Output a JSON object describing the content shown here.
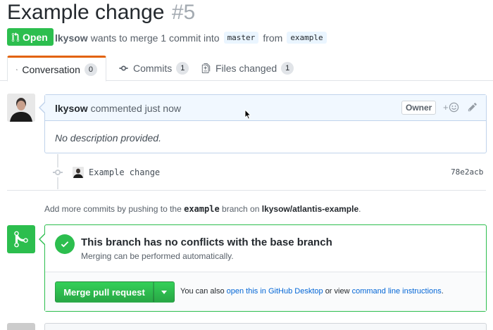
{
  "pr": {
    "title": "Example change",
    "number": "#5",
    "state": "Open",
    "author": "lkysow",
    "merge_text_1": "wants to merge 1 commit into",
    "base_branch": "master",
    "merge_text_2": "from",
    "head_branch": "example"
  },
  "tabs": [
    {
      "label": "Conversation",
      "count": "0",
      "icon": "comment-discussion-icon"
    },
    {
      "label": "Commits",
      "count": "1",
      "icon": "git-commit-icon"
    },
    {
      "label": "Files changed",
      "count": "1",
      "icon": "file-diff-icon"
    }
  ],
  "comment": {
    "author": "lkysow",
    "action": "commented just now",
    "badge": "Owner",
    "body": "No description provided."
  },
  "commit": {
    "message": "Example change",
    "sha": "78e2acb"
  },
  "push_note": {
    "prefix": "Add more commits by pushing to the",
    "branch": "example",
    "middle": "branch on",
    "repo": "lkysow/atlantis-example",
    "suffix": "."
  },
  "merge": {
    "title": "This branch has no conflicts with the base branch",
    "subtitle": "Merging can be performed automatically.",
    "button_label": "Merge pull request",
    "alt_prefix": "You can also",
    "alt_link1": "open this in GitHub Desktop",
    "alt_middle": "or view",
    "alt_link2": "command line instructions",
    "alt_suffix": "."
  },
  "colors": {
    "open_green": "#2cbe4e",
    "tab_accent": "#e36209",
    "link_blue": "#0366d6",
    "comment_header_bg": "#f1f8ff"
  }
}
